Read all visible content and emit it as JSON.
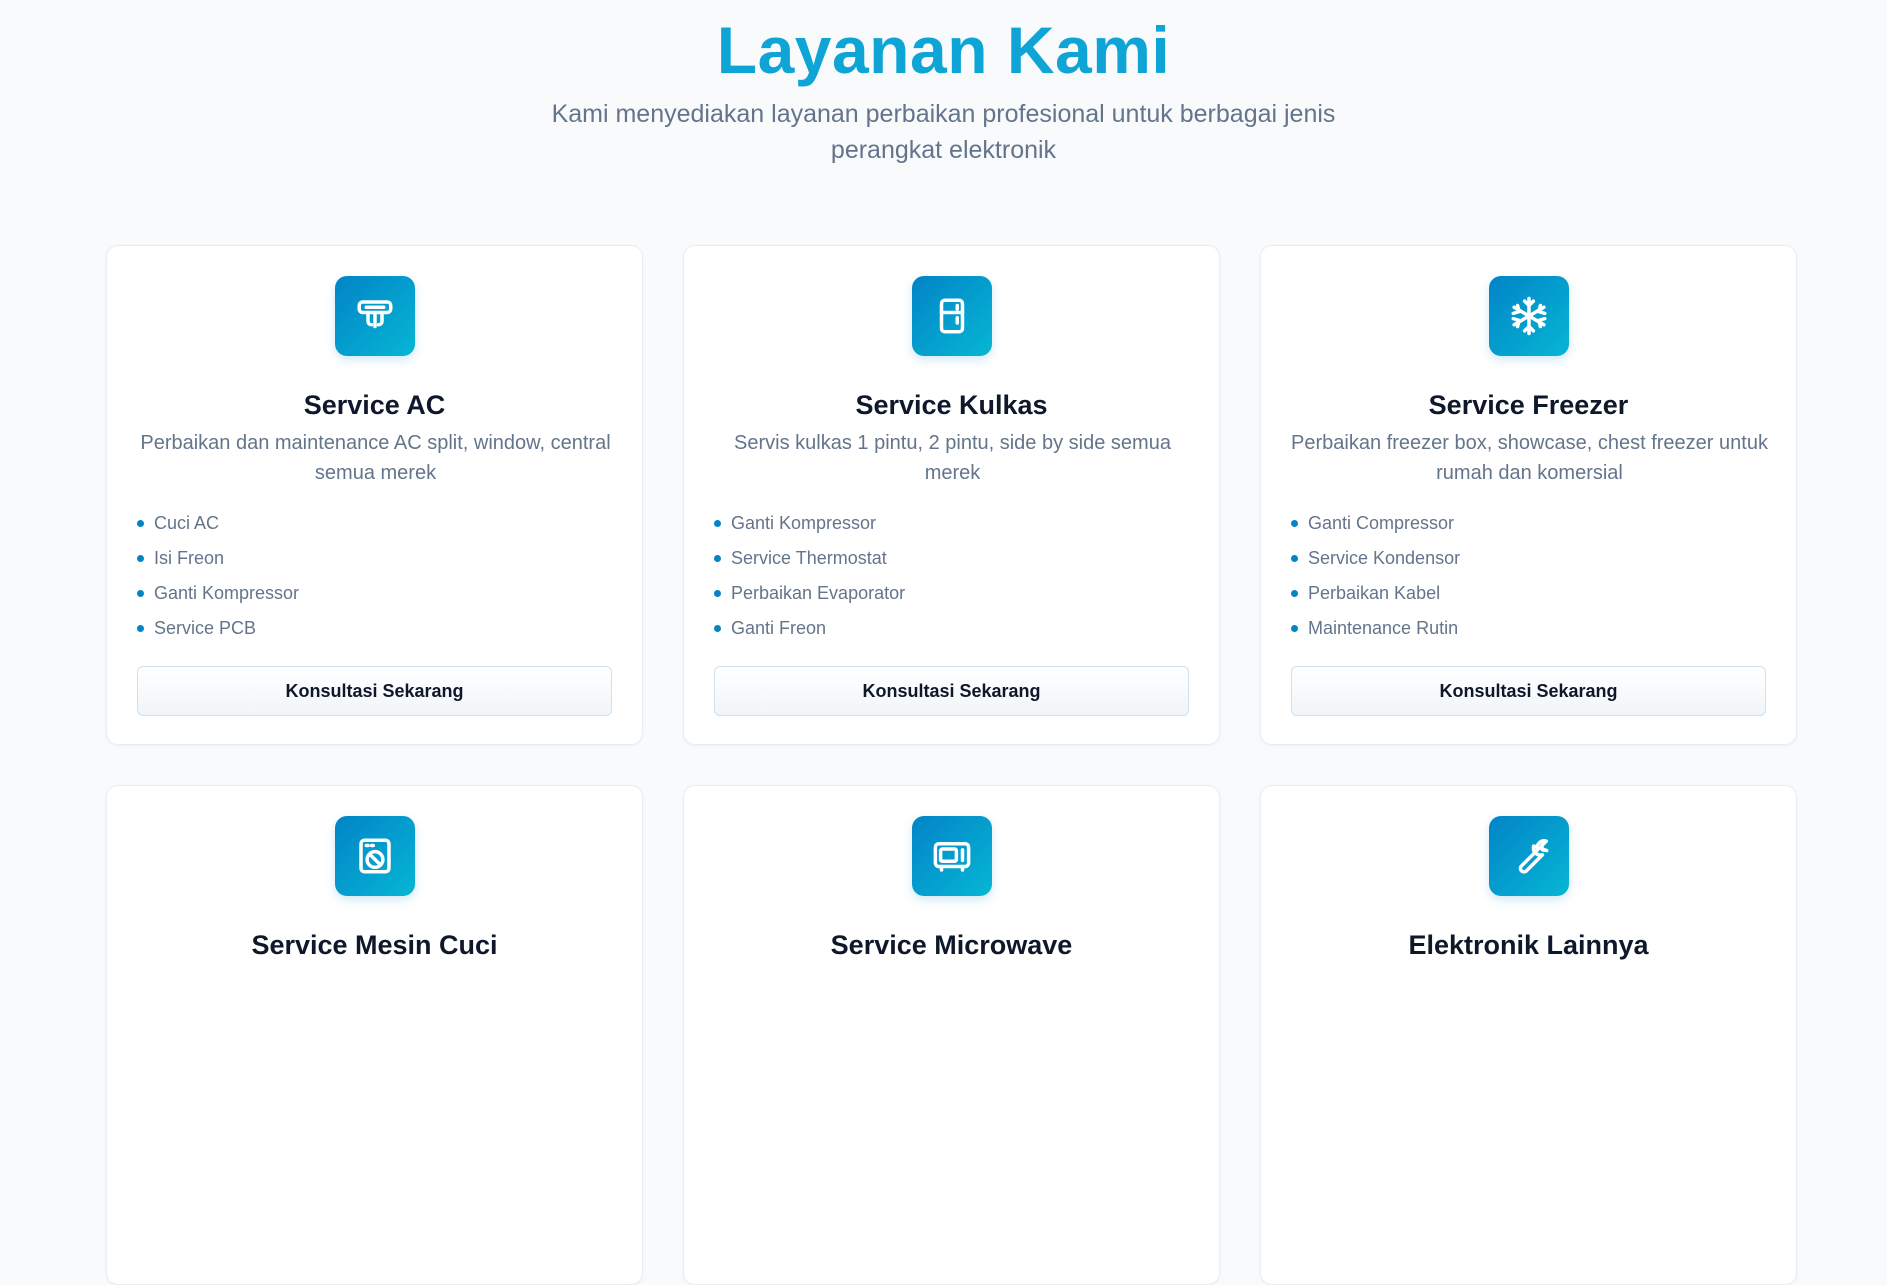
{
  "header": {
    "title": "Layanan Kami",
    "subtitle": "Kami menyediakan layanan perbaikan profesional untuk berbagai jenis perangkat elektronik"
  },
  "colors": {
    "accent": "#0ea5d6",
    "icon_gradient_start": "#0284c7",
    "icon_gradient_end": "#06b6d4",
    "muted_text": "#64748b",
    "card_background": "#ffffff",
    "page_background": "#f8fafc"
  },
  "services": [
    {
      "icon": "air-conditioner-icon",
      "title": "Service AC",
      "description": "Perbaikan dan maintenance AC split, window, central semua merek",
      "features": [
        "Cuci AC",
        "Isi Freon",
        "Ganti Kompressor",
        "Service PCB"
      ],
      "cta_label": "Konsultasi Sekarang"
    },
    {
      "icon": "refrigerator-icon",
      "title": "Service Kulkas",
      "description": "Servis kulkas 1 pintu, 2 pintu, side by side semua merek",
      "features": [
        "Ganti Kompressor",
        "Service Thermostat",
        "Perbaikan Evaporator",
        "Ganti Freon"
      ],
      "cta_label": "Konsultasi Sekarang"
    },
    {
      "icon": "snowflake-icon",
      "title": "Service Freezer",
      "description": "Perbaikan freezer box, showcase, chest freezer untuk rumah dan komersial",
      "features": [
        "Ganti Compressor",
        "Service Kondensor",
        "Perbaikan Kabel",
        "Maintenance Rutin"
      ],
      "cta_label": "Konsultasi Sekarang"
    },
    {
      "icon": "washing-machine-icon",
      "title": "Service Mesin Cuci"
    },
    {
      "icon": "microwave-icon",
      "title": "Service Microwave"
    },
    {
      "icon": "wrench-icon",
      "title": "Elektronik Lainnya"
    }
  ]
}
